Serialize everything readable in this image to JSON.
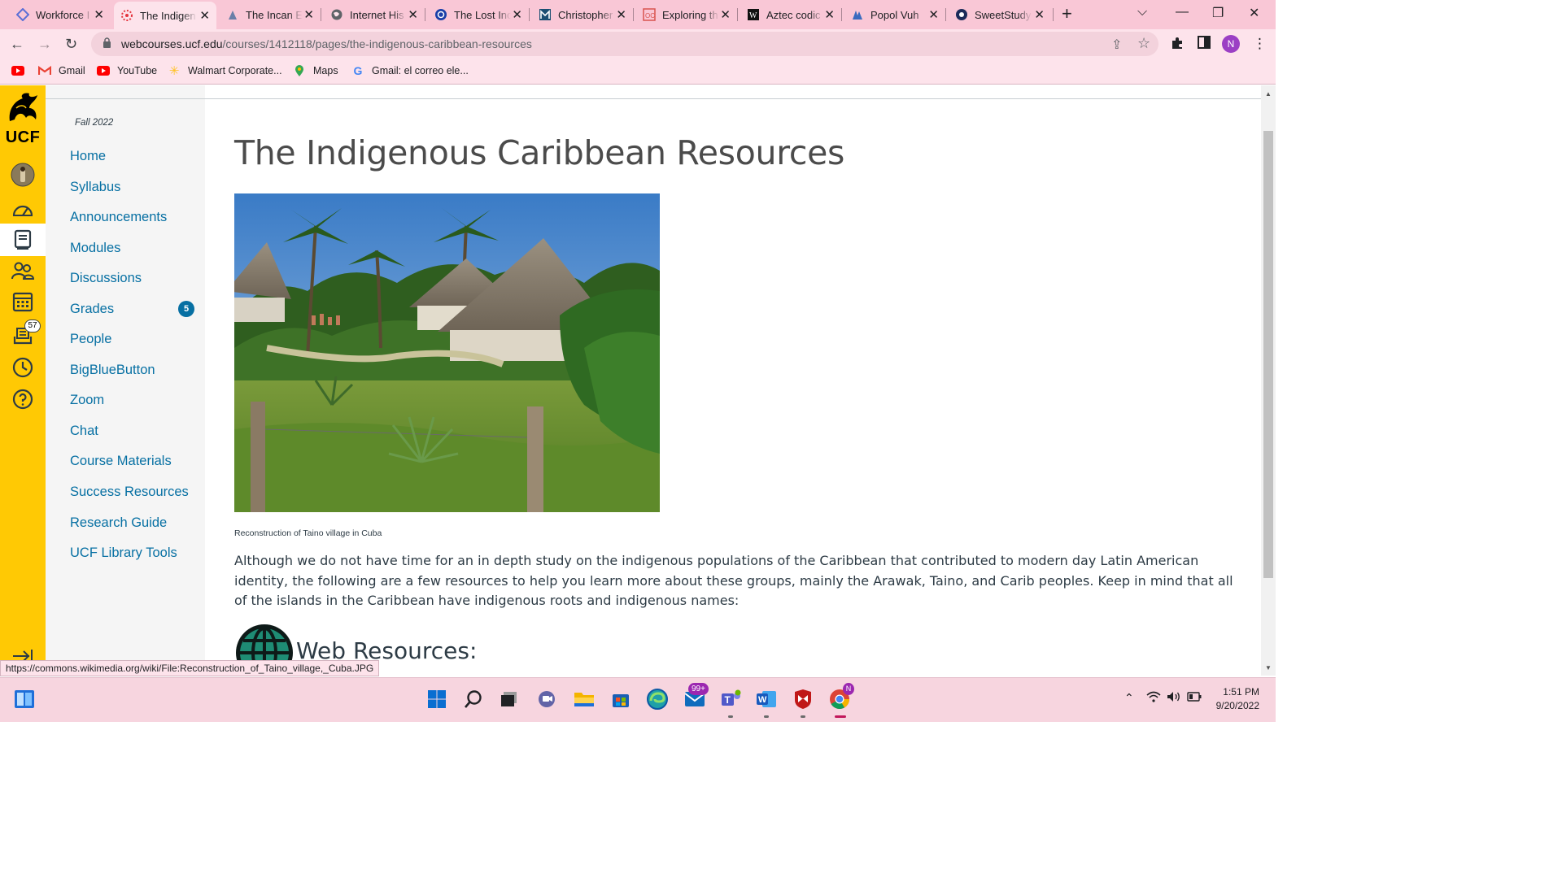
{
  "browser": {
    "tabs": [
      {
        "label": "Workforce I",
        "icon": "workforce-icon"
      },
      {
        "label": "The Indigen",
        "icon": "ucf-canvas-icon",
        "active": true
      },
      {
        "label": "The Incan E",
        "icon": "user-icon"
      },
      {
        "label": "Internet His",
        "icon": "globe-icon"
      },
      {
        "label": "The Lost Inc",
        "icon": "history-icon"
      },
      {
        "label": "Christopher",
        "icon": "m-icon"
      },
      {
        "label": "Exploring th",
        "icon": "oc-icon"
      },
      {
        "label": "Aztec codic",
        "icon": "w-icon"
      },
      {
        "label": "Popol Vuh",
        "icon": "arch-icon"
      },
      {
        "label": "SweetStudy",
        "icon": "sweetstudy-icon"
      }
    ],
    "url_domain": "webcourses.ucf.edu",
    "url_path": "/courses/1412118/pages/the-indigenous-caribbean-resources",
    "profile_initial": "N",
    "bookmarks": [
      {
        "label": "",
        "icon": "youtube-icon"
      },
      {
        "label": "Gmail",
        "icon": "gmail-icon"
      },
      {
        "label": "YouTube",
        "icon": "youtube-icon"
      },
      {
        "label": "Walmart Corporate...",
        "icon": "walmart-icon"
      },
      {
        "label": "Maps",
        "icon": "maps-icon"
      },
      {
        "label": "Gmail: el correo ele...",
        "icon": "google-icon"
      }
    ],
    "status_url": "https://commons.wikimedia.org/wiki/File:Reconstruction_of_Taino_village,_Cuba.JPG"
  },
  "global_nav": {
    "logo_text": "UCF",
    "inbox_badge": "57",
    "accent": "#ffc904"
  },
  "course_nav": {
    "term": "Fall 2022",
    "items": [
      {
        "label": "Home"
      },
      {
        "label": "Syllabus"
      },
      {
        "label": "Announcements"
      },
      {
        "label": "Modules"
      },
      {
        "label": "Discussions"
      },
      {
        "label": "Grades",
        "badge": "5"
      },
      {
        "label": "People"
      },
      {
        "label": "BigBlueButton"
      },
      {
        "label": "Zoom"
      },
      {
        "label": "Chat"
      },
      {
        "label": "Course Materials"
      },
      {
        "label": "Success Resources"
      },
      {
        "label": "Research Guide"
      },
      {
        "label": "UCF Library Tools"
      }
    ],
    "link_color": "#0770a3"
  },
  "page": {
    "title": "The Indigenous Caribbean Resources",
    "image_caption": "Reconstruction of Taino village in Cuba",
    "body": "Although we do not have time for an in depth study on the indigenous populations of the Caribbean that contributed to modern day Latin American identity, the following are a few resources to help you learn more about these groups, mainly the Arawak, Taino, and Carib peoples. Keep in mind that all of the islands in the Caribbean have indigenous roots and indigenous names:",
    "section_heading": "Web Resources:"
  },
  "taskbar": {
    "mail_badge": "99+",
    "chrome_badge": "N",
    "time": "1:51 PM",
    "date": "9/20/2022"
  }
}
